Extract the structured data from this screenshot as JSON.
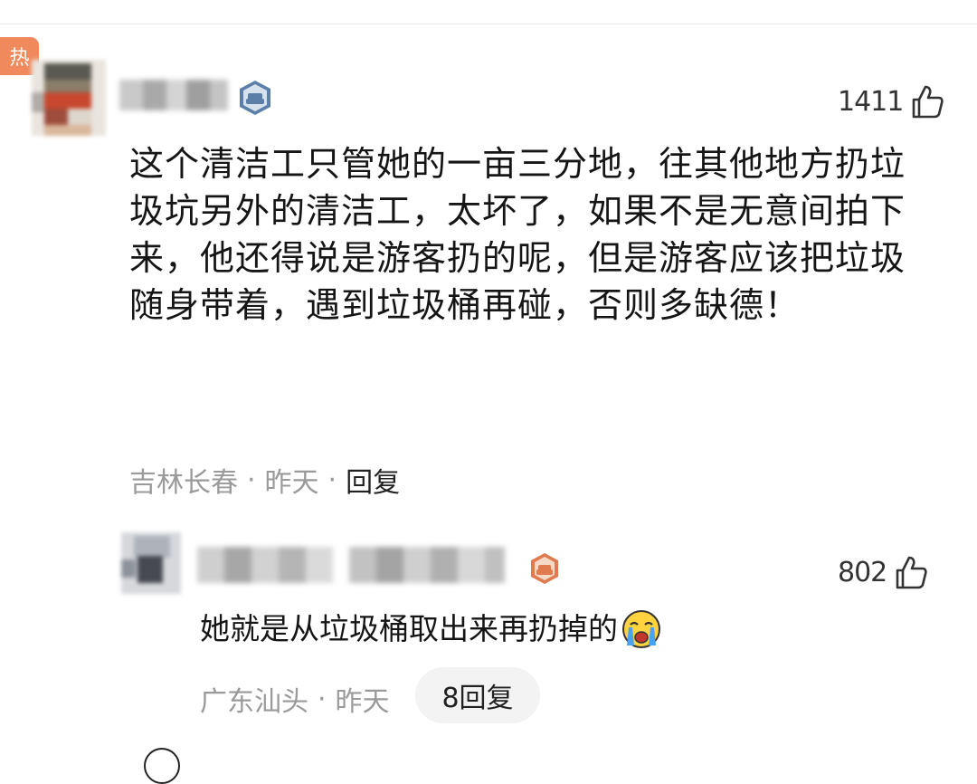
{
  "comment": {
    "hot_label": "热",
    "likes": "1411",
    "text": "这个清洁工只管她的一亩三分地，往其他地方扔垃圾坑另外的清洁工，太坏了，如果不是无意间拍下来，他还得说是游客扔的呢，但是游客应该把垃圾随身带着，遇到垃圾桶再碰，否则多缺德！",
    "location": "吉林长春",
    "separator": "·",
    "time": "昨天",
    "reply_label": "回复",
    "medal_color": "#5b7fa8"
  },
  "reply": {
    "likes": "802",
    "text": "她就是从垃圾桶取出来再扔掉的",
    "emoji": "crying-face-icon",
    "location": "广东汕头",
    "separator": "·",
    "time": "昨天",
    "replies_label": "8回复",
    "medal_color": "#e07a4f"
  },
  "colors": {
    "hot_badge": "#f08a5d",
    "meta_text": "#9a9a9a",
    "pill_bg": "#f3f3f3"
  }
}
